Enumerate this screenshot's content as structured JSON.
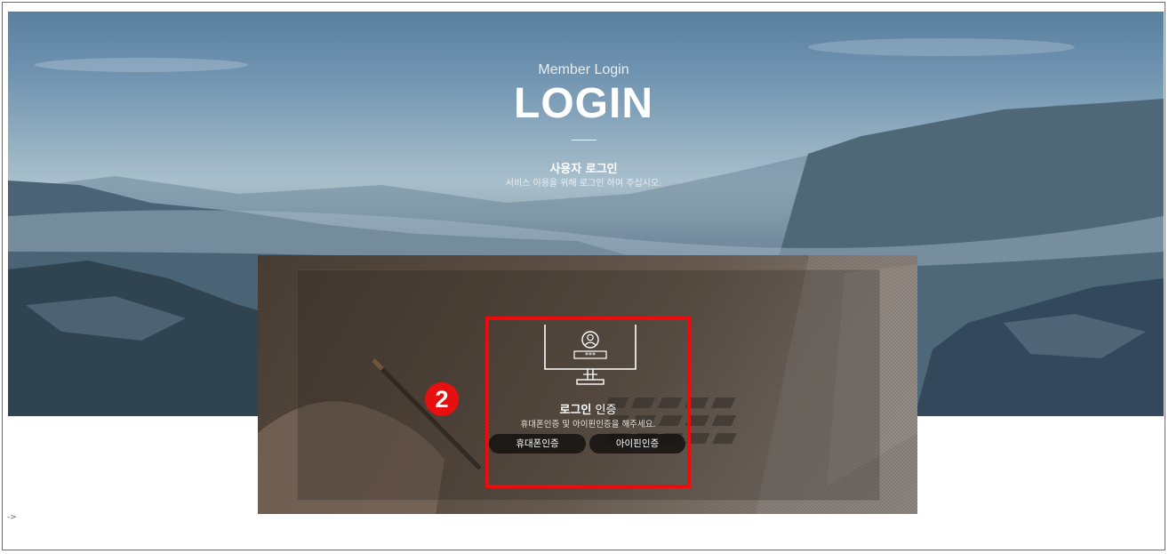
{
  "hero": {
    "subtitle": "Member Login",
    "title": "LOGIN",
    "heading": "사용자 로그인",
    "description": "서비스 이용을 위해 로그인 하여 주십시오."
  },
  "login_panel": {
    "title_bold": "로그인",
    "title_rest": " 인증",
    "description": "휴대폰인증 및 아이핀인증을 해주세요.",
    "phone_button": "휴대폰인증",
    "ipin_button": "아이핀인증",
    "monitor_password_mask": "***"
  },
  "annotation": {
    "step_number": "2",
    "highlight_color": "#ef0b0b"
  },
  "misc": {
    "arrow_text": "->"
  },
  "colors": {
    "marker": "#e8100f",
    "button_bg": "#141210"
  }
}
